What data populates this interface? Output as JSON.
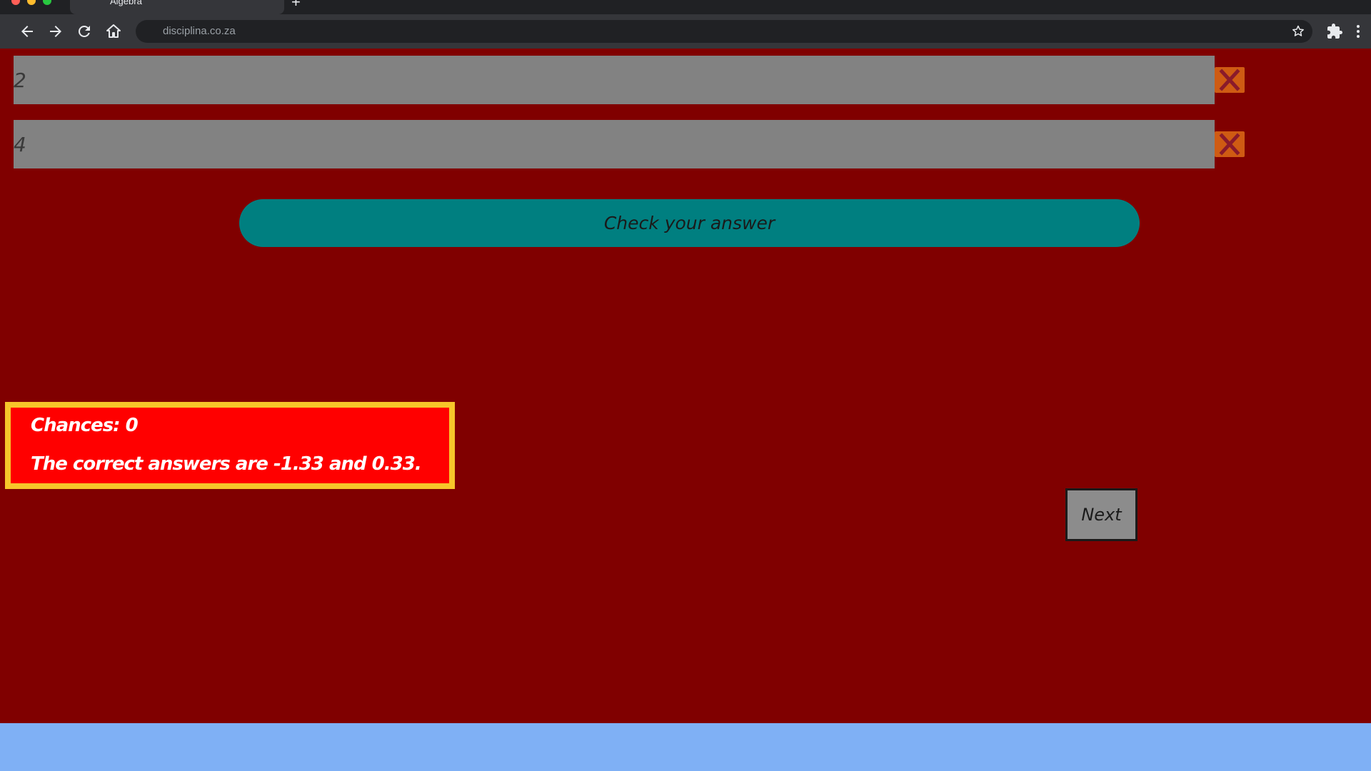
{
  "browser": {
    "tab_title": "Algebra",
    "new_tab_symbol": "+",
    "url": "disciplina.co.za",
    "icons": [
      "back-arrow-icon",
      "forward-arrow-icon",
      "reload-icon",
      "home-icon",
      "star-icon",
      "puzzle-extension-icon",
      "kebab-menu-icon"
    ]
  },
  "quiz": {
    "answer_1_value": "2",
    "answer_2_value": "4",
    "answer_1_status": "incorrect",
    "answer_2_status": "incorrect",
    "check_button_label": "Check your answer",
    "feedback": {
      "chances": "Chances: 0",
      "correct_answers": "The correct answers are -1.33 and 0.33."
    },
    "next_button_label": "Next"
  },
  "colors": {
    "page_background": "#800000",
    "answer_field": "#828282",
    "check_button": "#007f80",
    "incorrect_mark": "#cf5b13",
    "feedback_background": "#ff0000",
    "feedback_border": "#f7c62a",
    "desktop_background": "#7fb0f5"
  }
}
